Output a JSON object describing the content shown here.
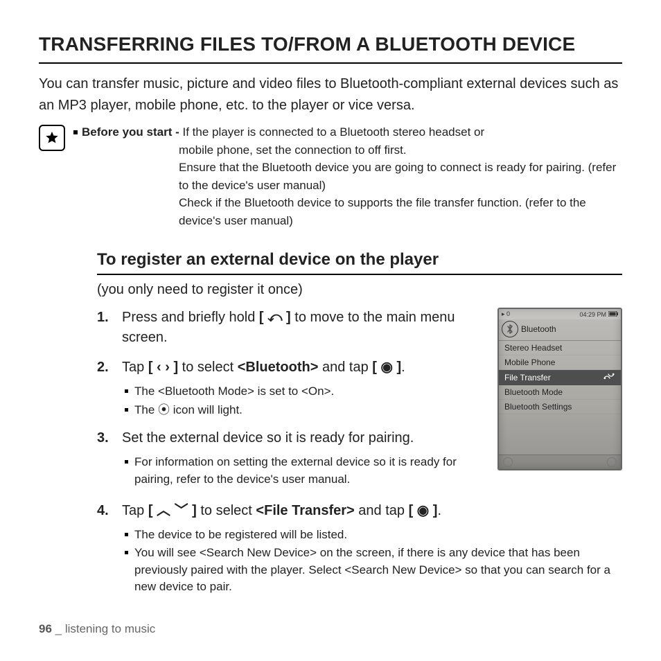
{
  "title": "TRANSFERRING FILES TO/FROM A BLUETOOTH DEVICE",
  "intro": "You can transfer music, picture and video files to Bluetooth-compliant external devices such as an MP3 player, mobile phone, etc. to the player or vice versa.",
  "note": {
    "lead": "Before you start - ",
    "line1": "If the player is connected to a Bluetooth stereo headset or",
    "rest": "mobile phone, set the connection to off first.\nEnsure that the Bluetooth device you are going to connect is ready for pairing. (refer to the device's user manual)\nCheck if the Bluetooth device to supports the file transfer function. (refer to the device's user manual)"
  },
  "subhead": "To register an external device on the player",
  "paren": "(you only need to register it once)",
  "steps": [
    {
      "pre": "Press and briefly hold ",
      "btn": "[ ⤺ ]",
      "post": " to move to the main menu screen.",
      "sub": []
    },
    {
      "pre": "Tap ",
      "btn": "[ ‹  › ]",
      "mid": " to select ",
      "bold": "<Bluetooth>",
      "post2": " and tap ",
      "btn2": "[ ◉ ]",
      "end": ".",
      "sub": [
        "The <Bluetooth Mode> is set to <On>.",
        "The ⦿ icon will light."
      ]
    },
    {
      "pre": "Set the external device so it is ready for pairing.",
      "sub": [
        "For information on setting the external device so it is ready for pairing, refer to the device's user manual."
      ]
    },
    {
      "pre": "Tap ",
      "btn": "[ ︿ ﹀ ]",
      "mid": " to select ",
      "bold": "<File Transfer>",
      "post2": " and tap ",
      "btn2": "[ ◉ ]",
      "end": ".",
      "sub": [
        "The device to be registered will be listed.",
        "You will see <Search New Device> on the screen, if there is any device that has been previously paired with the player. Select <Search New Device> so that you can search for a new device to pair."
      ]
    }
  ],
  "screen": {
    "status_left": "▸ 0",
    "status_time": "04:29 PM",
    "title": "Bluetooth",
    "items": [
      {
        "label": "Stereo Headset",
        "selected": false
      },
      {
        "label": "Mobile Phone",
        "selected": false
      },
      {
        "label": "File Transfer",
        "selected": true,
        "icon": "hand-swap"
      },
      {
        "label": "Bluetooth Mode",
        "selected": false
      },
      {
        "label": "Bluetooth Settings",
        "selected": false
      }
    ]
  },
  "footer": {
    "page": "96",
    "sep": " _ ",
    "section": "listening to music"
  }
}
